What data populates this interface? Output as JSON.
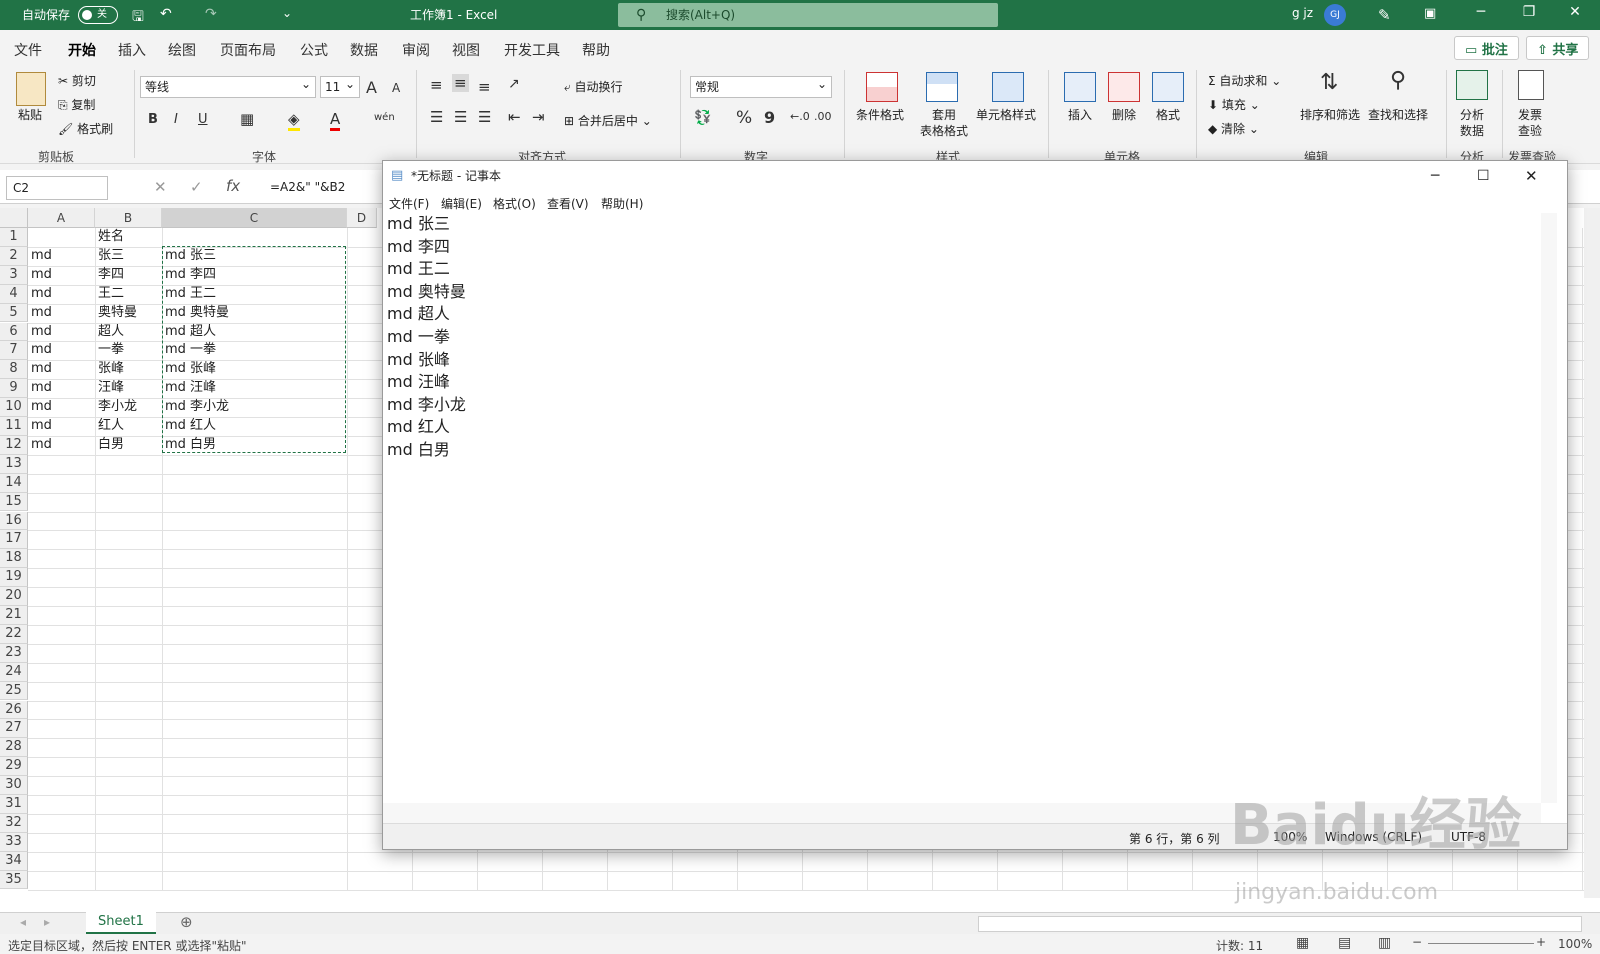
{
  "titlebar": {
    "autosave_label": "自动保存",
    "autosave_state": "关",
    "doc_title": "工作簿1 - Excel",
    "search_placeholder": "搜索(Alt+Q)",
    "user_name": "g jz",
    "user_initials": "GJ"
  },
  "tabs": [
    "文件",
    "开始",
    "插入",
    "绘图",
    "页面布局",
    "公式",
    "数据",
    "审阅",
    "视图",
    "开发工具",
    "帮助"
  ],
  "active_tab": "开始",
  "top_buttons": {
    "comments": "批注",
    "share": "共享"
  },
  "ribbon": {
    "clipboard": {
      "paste": "粘贴",
      "cut": "剪切",
      "copy": "复制",
      "format_painter": "格式刷",
      "group": "剪贴板"
    },
    "font": {
      "name": "等线",
      "size": "11",
      "group": "字体",
      "bold": "B",
      "italic": "I",
      "underline": "U",
      "grow": "A",
      "shrink": "A"
    },
    "alignment": {
      "wrap": "自动换行",
      "merge": "合并后居中",
      "group": "对齐方式"
    },
    "number": {
      "format": "常规",
      "group": "数字",
      "percent": "%",
      "comma": "9"
    },
    "styles": {
      "conditional": "条件格式",
      "table_line1": "套用",
      "table_line2": "表格格式",
      "cell_styles": "单元格样式",
      "group": "样式"
    },
    "cells": {
      "insert": "插入",
      "delete": "删除",
      "format": "格式",
      "group": "单元格"
    },
    "editing": {
      "autosum": "自动求和",
      "fill": "填充",
      "clear": "清除",
      "sort": "排序和筛选",
      "find": "查找和选择",
      "group": "编辑"
    },
    "analysis": {
      "analyze_l1": "分析",
      "analyze_l2": "数据",
      "group": "分析"
    },
    "invoice": {
      "l1": "发票",
      "l2": "查验",
      "group": "发票查验"
    }
  },
  "formula_bar": {
    "name_box": "C2",
    "fx": "fx",
    "formula": "=A2&\" \"&B2"
  },
  "sheet": {
    "columns": [
      "A",
      "B",
      "C",
      "D"
    ],
    "row_numbers": [
      "1",
      "2",
      "3",
      "4",
      "5",
      "6",
      "7",
      "8",
      "9",
      "10",
      "11",
      "12",
      "13",
      "14",
      "15",
      "16",
      "17",
      "18",
      "19",
      "20",
      "21",
      "22",
      "23",
      "24",
      "25",
      "26",
      "27",
      "28",
      "29",
      "30",
      "31",
      "32",
      "33",
      "34",
      "35"
    ],
    "rows": [
      {
        "a": "",
        "b": "姓名",
        "c": ""
      },
      {
        "a": "md",
        "b": "张三",
        "c": "md 张三"
      },
      {
        "a": "md",
        "b": "李四",
        "c": "md 李四"
      },
      {
        "a": "md",
        "b": "王二",
        "c": "md 王二"
      },
      {
        "a": "md",
        "b": "奥特曼",
        "c": "md 奥特曼"
      },
      {
        "a": "md",
        "b": "超人",
        "c": "md 超人"
      },
      {
        "a": "md",
        "b": "一拳",
        "c": "md 一拳"
      },
      {
        "a": "md",
        "b": "张峰",
        "c": "md 张峰"
      },
      {
        "a": "md",
        "b": "汪峰",
        "c": "md 汪峰"
      },
      {
        "a": "md",
        "b": "李小龙",
        "c": "md 李小龙"
      },
      {
        "a": "md",
        "b": "红人",
        "c": "md 红人"
      },
      {
        "a": "md",
        "b": "白男",
        "c": "md 白男"
      }
    ]
  },
  "sheet_tab": "Sheet1",
  "statusbar": {
    "message": "选定目标区域，然后按 ENTER 或选择\"粘贴\"",
    "count": "计数: 11",
    "zoom": "100%"
  },
  "notepad": {
    "title": "*无标题 - 记事本",
    "menu": [
      "文件(F)",
      "编辑(E)",
      "格式(O)",
      "查看(V)",
      "帮助(H)"
    ],
    "lines": [
      "md 张三",
      "md 李四",
      "md 王二",
      "md 奥特曼",
      "md 超人",
      "md 一拳",
      "md 张峰",
      "md 汪峰",
      "md 李小龙",
      "md 红人",
      "md 白男"
    ],
    "status_position": "第 6 行，第 6 列",
    "status_zoom": "100%",
    "status_eol": "Windows (CRLF)",
    "status_encoding": "UTF-8"
  },
  "watermark": {
    "text": "Baidu经验",
    "url": "jingyan.baidu.com"
  }
}
